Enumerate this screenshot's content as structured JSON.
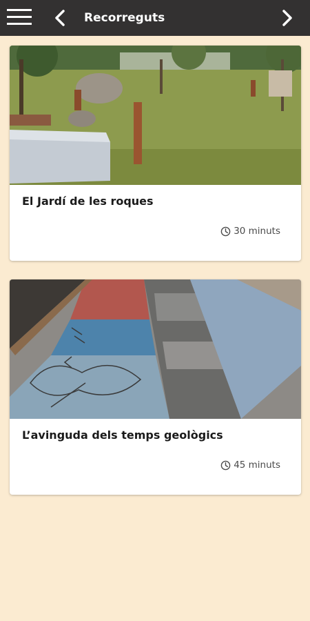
{
  "appbar": {
    "title": "Recorreguts",
    "menu_icon": "hamburger-menu-icon",
    "back_icon": "chevron-left-icon",
    "forward_icon": "chevron-right-icon"
  },
  "routes": [
    {
      "title": "El Jardí de les roques",
      "duration": "30 minuts",
      "icon": "clock-icon"
    },
    {
      "title": "L’avinguda dels temps geològics",
      "duration": "45 minuts",
      "icon": "clock-icon"
    }
  ],
  "colors": {
    "appbar": "#333131",
    "background": "#fbebd1",
    "card": "#ffffff"
  }
}
